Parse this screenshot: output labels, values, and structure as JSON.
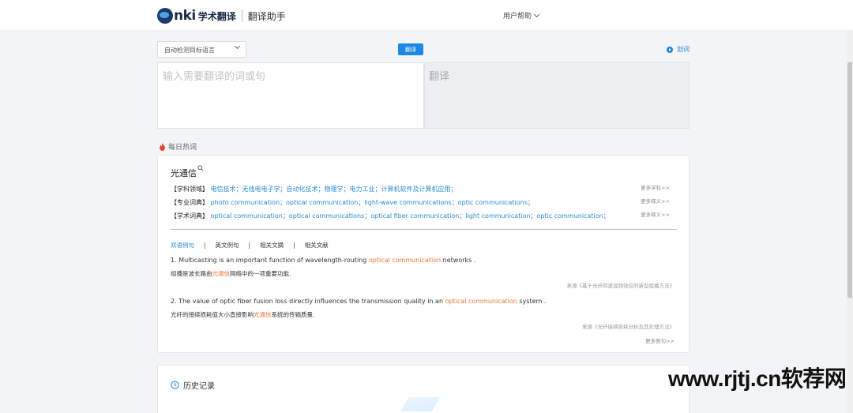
{
  "header": {
    "logo_mark": "nki",
    "logo_cn": "学术翻译",
    "subtitle": "翻译助手",
    "help_label": "用户帮助"
  },
  "toolbar": {
    "lang_select_value": "自动检测目标语言",
    "translate_label": "翻译",
    "huaci_label": "划词"
  },
  "editor": {
    "input_placeholder": "输入需要翻译的词或句",
    "output_placeholder": "翻译"
  },
  "hot": {
    "title": "每日热词",
    "word": "光通信",
    "rows": [
      {
        "tag": "【学科领域】",
        "value": "电信技术；无线电电子学；自动化技术；物理学；电力工业；计算机软件及计算机应用；",
        "more": "更多学科>>"
      },
      {
        "tag": "【专业词典】",
        "value": "photo communication；optical communication；light-wave communications；optic communications；",
        "more": "更多释义>>"
      },
      {
        "tag": "【学术词典】",
        "value": "optical communication；optical communications；optical fiber communication；light communication；optic communication；",
        "more": "更多释义>>"
      }
    ],
    "tabs": [
      "双语例句",
      "英文例句",
      "相关文摘",
      "相关文献"
    ],
    "examples": [
      {
        "en_pre": "1. Multicasting is an important function of wavelength-routing ",
        "en_hl": "optical communication",
        "en_post": " networks .",
        "cn_pre": "组播是波长路由",
        "cn_hl": "光通信",
        "cn_post": "网络中的一项重要功能.",
        "source": "来源《基于光纤四波混频效应的新型组播方法》"
      },
      {
        "en_pre": "2. The value of optic fiber fusion loss directly influences the transmission quality in an ",
        "en_hl": "optical communication",
        "en_post": " system .",
        "cn_pre": "光纤的接续损耗值大小直接影响",
        "cn_hl": "光通信",
        "cn_post": "系统的传输质量.",
        "source": "来源《光纤接续损耗分析及其处理方法》"
      }
    ],
    "more_examples": "更多例句>>"
  },
  "history": {
    "title": "历史记录"
  },
  "watermark": "www.rjtj.cn软荐网"
}
